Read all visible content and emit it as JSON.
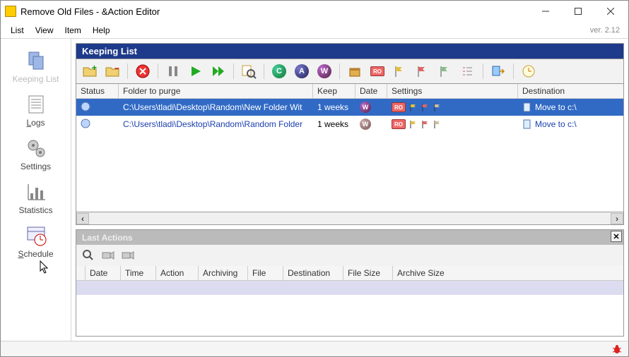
{
  "window": {
    "title": "Remove Old Files - &Action Editor"
  },
  "menu": {
    "items": [
      "List",
      "View",
      "Item",
      "Help"
    ],
    "version": "ver. 2.12"
  },
  "sidebar": {
    "items": [
      {
        "label": "Keeping List",
        "disabled": true,
        "underline": null
      },
      {
        "label": "Logs",
        "underline": 0
      },
      {
        "label": "Settings",
        "underline": null
      },
      {
        "label": "Statistics",
        "underline": null
      },
      {
        "label": "Schedule",
        "underline": 0
      }
    ]
  },
  "keeping_list": {
    "title": "Keeping List",
    "columns": [
      "Status",
      "Folder to purge",
      "Keep",
      "Date",
      "Settings",
      "Destination"
    ],
    "rows": [
      {
        "selected": true,
        "folder": "C:\\Users\\tladi\\Desktop\\Random\\New Folder Wit",
        "keep": "1 weeks",
        "date": "W",
        "dest_label": "Move to c:\\"
      },
      {
        "selected": false,
        "folder": "C:\\Users\\tladi\\Desktop\\Random\\Random Folder",
        "keep": "1 weeks",
        "date": "W",
        "dest_label": "Move to c:\\"
      }
    ]
  },
  "last_actions": {
    "title": "Last Actions",
    "columns": [
      "Date",
      "Time",
      "Action",
      "Archiving",
      "File",
      "Destination",
      "File Size",
      "Archive Size"
    ]
  }
}
